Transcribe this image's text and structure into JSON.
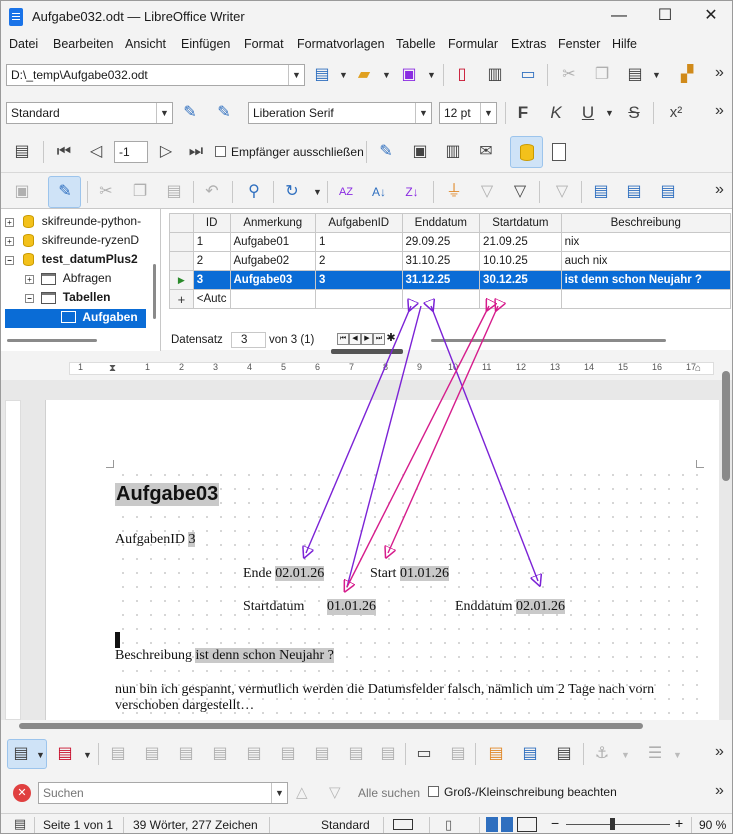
{
  "window": {
    "title": "Aufgabe032.odt — LibreOffice Writer",
    "min": "—",
    "max": "☐",
    "close": "✕"
  },
  "menu": [
    "Datei",
    "Bearbeiten",
    "Ansicht",
    "Einfügen",
    "Format",
    "Formatvorlagen",
    "Tabelle",
    "Formular",
    "Extras",
    "Fenster",
    "Hilfe"
  ],
  "standard_toolbar": {
    "path": "D:\\_temp\\Aufgabe032.odt"
  },
  "format_toolbar": {
    "paragraph_style": "Standard",
    "font_name": "Liberation Serif",
    "font_size": "12 pt",
    "bold": "F",
    "italic": "K",
    "underline": "U",
    "strike": "S",
    "superscript": "x²"
  },
  "mailmerge_toolbar": {
    "record": "-1",
    "exclude_label": "Empfänger ausschließen"
  },
  "datasource_tree": {
    "items": [
      {
        "label": "skifreunde-python-",
        "expander": "+"
      },
      {
        "label": "skifreunde-ryzenD",
        "expander": "+"
      },
      {
        "label": "test_datumPlus2",
        "expander": "−"
      },
      {
        "label": "Abfragen",
        "expander": "+"
      },
      {
        "label": "Tabellen",
        "expander": "−"
      },
      {
        "label": "Aufgaben"
      }
    ]
  },
  "grid": {
    "columns": [
      "ID",
      "Anmerkung",
      "AufgabenID",
      "Enddatum",
      "Startdatum",
      "Beschreibung"
    ],
    "rows": [
      {
        "marker": "",
        "cells": [
          "1",
          "Aufgabe01",
          "1",
          "29.09.25",
          "21.09.25",
          "nix"
        ]
      },
      {
        "marker": "",
        "cells": [
          "2",
          "Aufgabe02",
          "2",
          "31.10.25",
          "10.10.25",
          "auch nix"
        ]
      },
      {
        "marker": "▶",
        "cells": [
          "3",
          "Aufgabe03",
          "3",
          "31.12.25",
          "30.12.25",
          "ist denn schon Neujahr ?"
        ]
      },
      {
        "marker": "+",
        "cells": [
          "<Autc",
          "",
          "",
          "",
          "",
          ""
        ]
      }
    ]
  },
  "record_nav": {
    "label": "Datensatz",
    "current": "3",
    "of": "von 3 (1)"
  },
  "ruler": {
    "numbers": [
      "1",
      "1",
      "2",
      "3",
      "4",
      "5",
      "6",
      "7",
      "8",
      "9",
      "10",
      "11",
      "12",
      "13",
      "14",
      "15",
      "16",
      "17"
    ]
  },
  "document": {
    "heading": "Aufgabe03",
    "aufgaben_label": "AufgabenID",
    "aufgaben_value": "3",
    "ende_label": "Ende",
    "ende_value": "02.01.26",
    "start_label": "Start",
    "start_value": "01.01.26",
    "startdatum_label": "Startdatum",
    "startdatum_value": "01.01.26",
    "enddatum_label": "Enddatum",
    "enddatum_value": "02.01.26",
    "beschreibung_label": "Beschreibung",
    "beschreibung_value": "ist denn schon Neujahr ?",
    "para_line1": "nun bin ich gespannt, vermutlich werden die Datumsfelder falsch, nämlich um 2 Tage nach vorn",
    "para_line2": "verschoben dargestellt…"
  },
  "annotation_colors": {
    "purple": "#7b22d6",
    "magenta": "#d61c8c"
  },
  "findbar": {
    "placeholder": "Suchen",
    "find_all": "Alle suchen",
    "match_case": "Groß-/Kleinschreibung beachten"
  },
  "statusbar": {
    "page": "Seite 1 von 1",
    "words": "39 Wörter, 277 Zeichen",
    "style": "Standard",
    "zoom": "90 %"
  }
}
